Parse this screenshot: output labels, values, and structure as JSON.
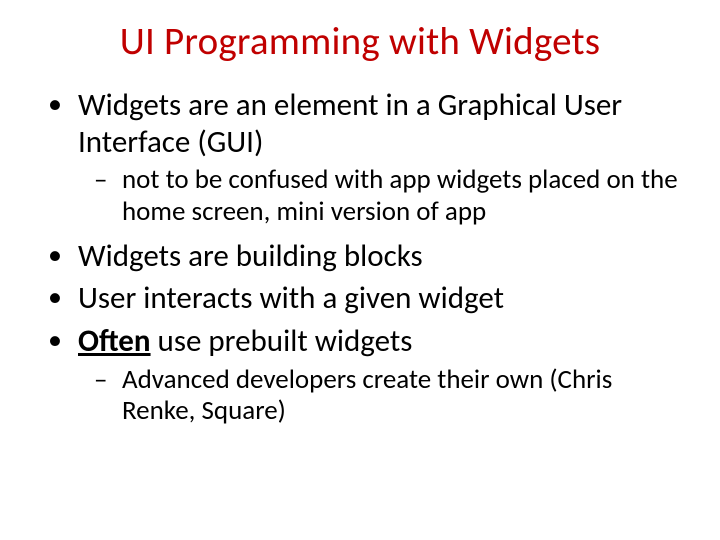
{
  "title": "UI Programming with Widgets",
  "bullets": [
    {
      "text": "Widgets are an element in a Graphical User Interface (GUI)",
      "sub": [
        {
          "text": "not to be confused with app widgets placed on the home screen, mini version of app"
        }
      ]
    },
    {
      "text": "Widgets are building blocks"
    },
    {
      "text": "User interacts with a given widget"
    },
    {
      "prefix_underline_bold": "Often",
      "rest": " use prebuilt widgets",
      "sub": [
        {
          "text": "Advanced developers create their own (Chris Renke, Square)"
        }
      ]
    }
  ]
}
